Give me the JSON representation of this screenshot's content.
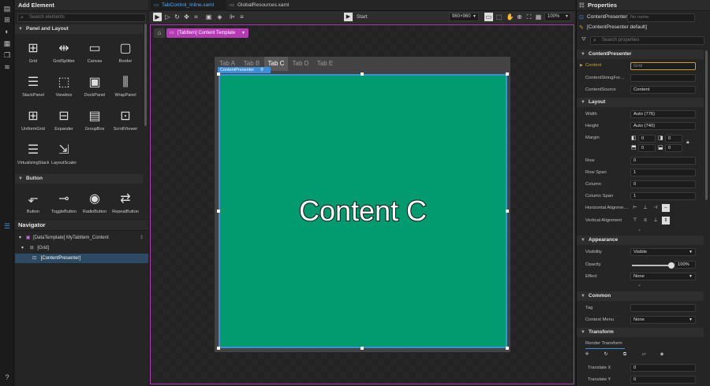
{
  "left_panel": {
    "title": "Add Element",
    "search_placeholder": "Search elements",
    "categories": [
      {
        "label": "Panel and Layout"
      },
      {
        "label": "Button"
      }
    ],
    "panel_items": [
      "Grid",
      "GridSplitter",
      "Canvas",
      "Border",
      "StackPanel",
      "Viewbox",
      "DockPanel",
      "WrapPanel",
      "UniformGrid",
      "Expander",
      "GroupBox",
      "ScrollViewer",
      "VirtualizingStack…",
      "LayoutScaler"
    ],
    "button_items": [
      "Button",
      "ToggleButton",
      "RadioButton",
      "RepeatButton"
    ]
  },
  "navigator": {
    "title": "Navigator",
    "rows": [
      "[DataTemplate] MyTabItem_Content",
      "[Grid]",
      "[ContentPresenter]"
    ]
  },
  "doc_tabs": [
    {
      "label": "TabControl_Inline.xaml"
    },
    {
      "label": "GlobalResources.xaml"
    }
  ],
  "toolbar": {
    "start_label": "Start",
    "resolution": "960×960",
    "zoom": "100%"
  },
  "breadcrumb": {
    "label": "[TabItem] Content Template"
  },
  "tab_control": {
    "tabs": [
      "Tab A",
      "Tab B",
      "Tab C",
      "Tab D",
      "Tab E"
    ],
    "selected": "Tab C",
    "adorner_label": "ContentPresenter",
    "content_text": "Content C",
    "content_color": "#019b6f"
  },
  "properties": {
    "title": "Properties",
    "element_type": "ContentPresenter",
    "name_placeholder": "No name",
    "style_label": "[ContentPresenter default]",
    "search_placeholder": "Search properties",
    "section_main": "ContentPresenter",
    "content": {
      "label": "Content",
      "value": "Grid"
    },
    "content_string_format": {
      "label": "ContentStringFor…",
      "value": ""
    },
    "content_source": {
      "label": "ContentSource",
      "value": "Content"
    },
    "layout": {
      "title": "Layout",
      "width_label": "Width",
      "width": "Auto (776)",
      "height_label": "Height",
      "height": "Auto (740)",
      "margin_label": "Margin",
      "margin": [
        "0",
        "0",
        "0",
        "0"
      ],
      "row_label": "Row",
      "row": "0",
      "row_span_label": "Row Span",
      "row_span": "1",
      "column_label": "Column",
      "column": "0",
      "column_span_label": "Column Span",
      "column_span": "1",
      "halign_label": "Horizontal Alignme…",
      "valign_label": "Vertical Alignment"
    },
    "appearance": {
      "title": "Appearance",
      "visibility_label": "Visibility",
      "visibility": "Visible",
      "opacity_label": "Opacity",
      "opacity": "100%",
      "opacity_value": 1.0,
      "effect_label": "Effect",
      "effect": "None"
    },
    "common": {
      "title": "Common",
      "tag_label": "Tag",
      "tag": "",
      "context_menu_label": "Context Menu",
      "context_menu": "None"
    },
    "transform": {
      "title": "Transform",
      "render_transform_label": "Render Transform",
      "translate_x_label": "Translate X",
      "translate_x": "0",
      "translate_y_label": "Translate Y",
      "translate_y": "0"
    }
  },
  "colors": {
    "accent": "#3c8fd8",
    "selection_frame": "#b43bb4",
    "content_green": "#019b6f",
    "active_field": "#c9a227"
  }
}
